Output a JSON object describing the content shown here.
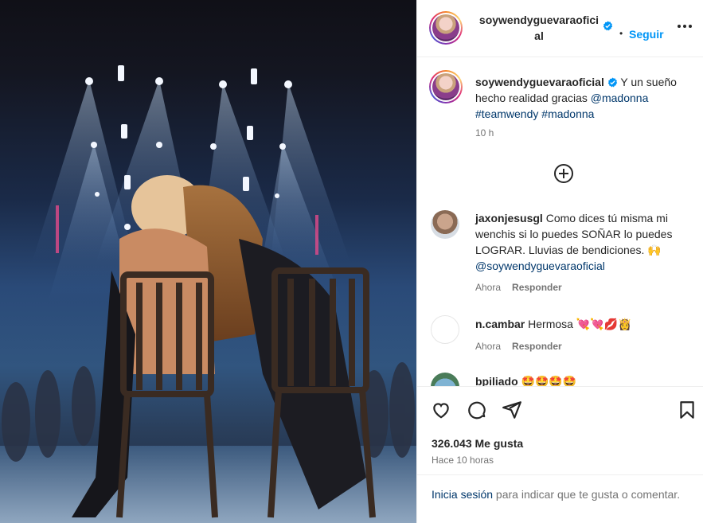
{
  "post": {
    "author": "soywendyguevaraoficial",
    "author_line1": "soywendyguevaraofici",
    "author_line2": "al",
    "dot": "•",
    "follow_label": "Seguir",
    "more_icon": "more-dots-icon",
    "verified_color": "#0095f6"
  },
  "caption": {
    "author": "soywendyguevaraoficial",
    "text": " Y un sueño hecho realidad gracias ",
    "mention": "@madonna",
    "tag1": "#teamwendy",
    "tag2": "#madonna",
    "time": "10 h"
  },
  "comments": [
    {
      "user": "jaxonjesusgl",
      "text": " Como dices tú misma mi wenchis si lo puedes SOÑAR lo puedes LOGRAR. Lluvias de bendiciones. 🙌",
      "mention": "@soywendyguevaraoficial",
      "time": "Ahora",
      "reply": "Responder"
    },
    {
      "user": "n.cambar",
      "text": " Hermosa 💘💘💋👸",
      "time": "Ahora",
      "reply": "Responder"
    },
    {
      "user": "bpiliado",
      "text": " 🤩🤩🤩🤩"
    }
  ],
  "actions": {
    "likes": "326.043 Me gusta",
    "ago": "Hace 10 horas",
    "login_link": "Inicia sesión",
    "login_rest": " para indicar que te gusta o comentar."
  },
  "colors": {
    "accent": "#0095f6",
    "link": "#00376b",
    "muted": "#737373",
    "text": "#262626"
  }
}
